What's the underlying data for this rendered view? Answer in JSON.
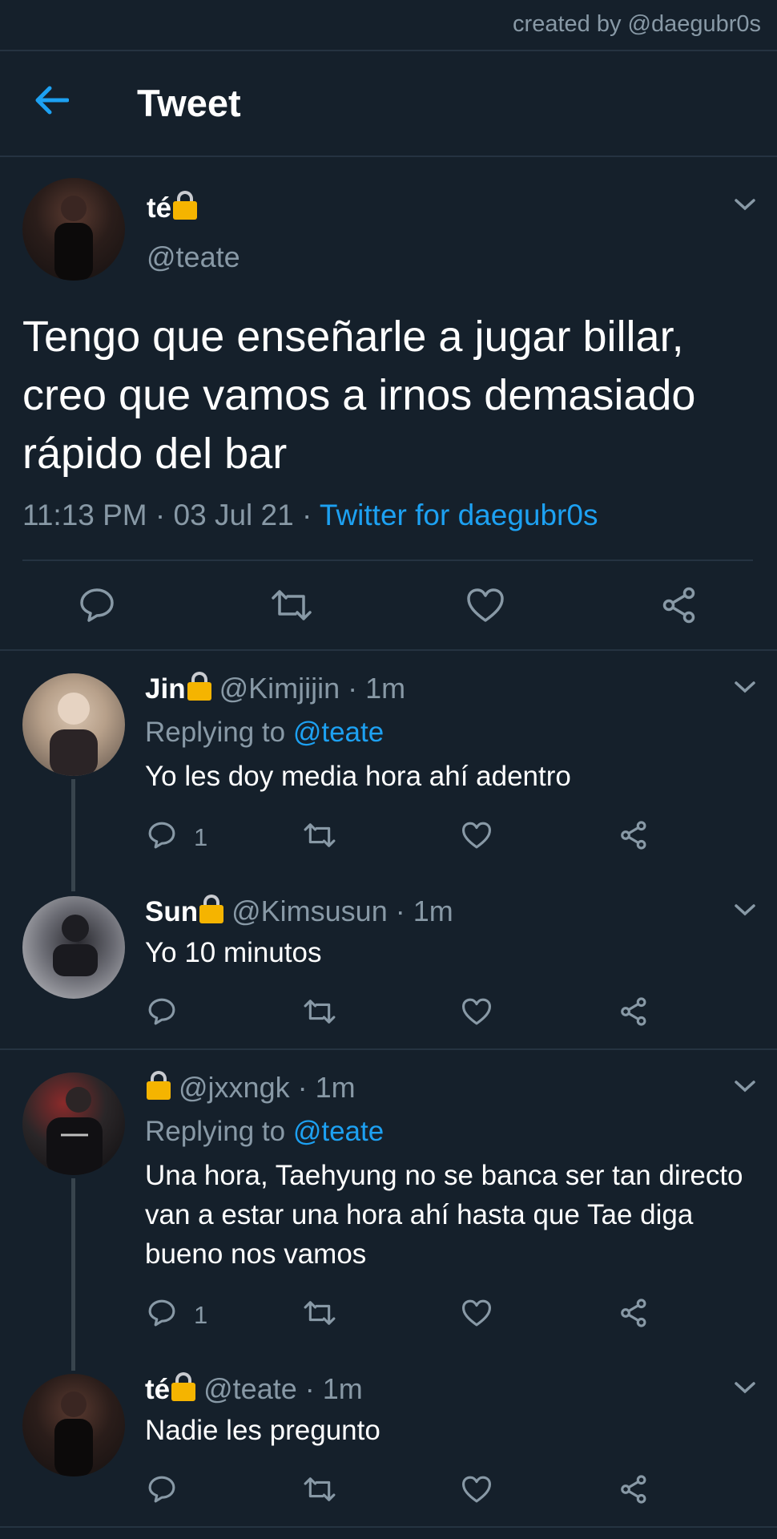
{
  "credit": "created by @daegubr0s",
  "header": {
    "title": "Tweet"
  },
  "colors": {
    "background": "#15202b",
    "accent": "#1da1f2",
    "muted": "#8899a6",
    "divider": "#253341"
  },
  "main_tweet": {
    "name": "té",
    "handle": "@teate",
    "text": "Tengo que enseñarle a jugar billar, creo que vamos a irnos demasiado rápido del bar",
    "time": "11:13 PM · 03 Jul 21 · ",
    "source": "Twitter for daegubr0s",
    "actions": [
      "reply-icon",
      "retweet-icon",
      "like-icon",
      "share-icon"
    ]
  },
  "replies": [
    {
      "name": "Jin",
      "meta": " @Kimjijin · 1m",
      "replying_label": "Replying to ",
      "replying_to": "@teate",
      "text": "Yo les doy media hora ahí adentro",
      "reply_count": "1"
    },
    {
      "name": "Sun",
      "meta": " @Kimsusun · 1m",
      "text": "Yo 10 minutos",
      "reply_count": ""
    },
    {
      "name": "",
      "meta": " @jxxngk · 1m",
      "replying_label": "Replying to ",
      "replying_to": "@teate",
      "text": "Una hora, Taehyung no se banca ser tan directo van a estar una hora ahí hasta que Tae diga bueno nos vamos",
      "reply_count": "1"
    },
    {
      "name": "té",
      "meta": " @teate · 1m",
      "text": "Nadie les pregunto",
      "reply_count": ""
    }
  ]
}
